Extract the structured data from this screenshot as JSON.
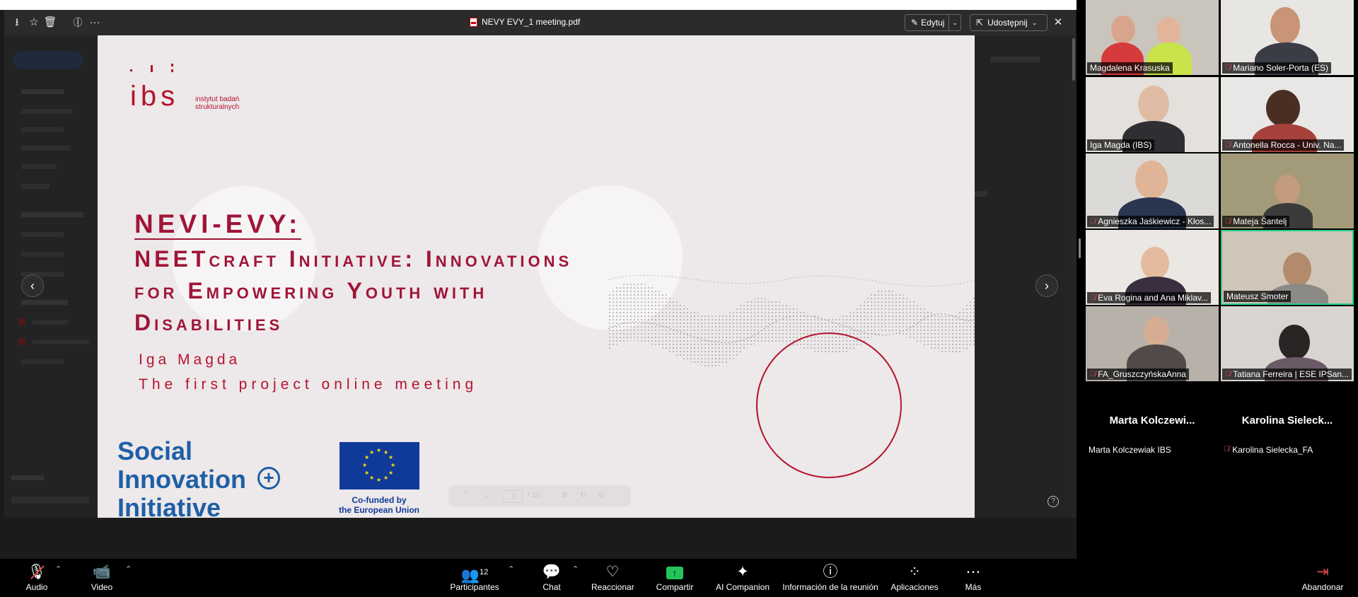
{
  "viewer": {
    "doc_title": "NEVY EVY_1 meeting.pdf",
    "edit_label": "Edytuj",
    "share_label": "Udostępnij",
    "page_current": "1",
    "page_total": "/ 10"
  },
  "slide": {
    "ibs_logo": "ibs",
    "ibs_text": "instytut badań strukturalnych",
    "title": "NEVI-EVY:",
    "subtitle_lines": [
      "NEETcraft Initiative: Innovations",
      "for Empowering Youth with",
      "Disabilities"
    ],
    "author": "Iga Magda",
    "meeting": "The first project online meeting",
    "sii_lines": [
      "Social",
      "Innovation",
      "Initiative"
    ],
    "sii_plus": "+",
    "eu_text_1": "Co-funded by",
    "eu_text_2": "the European Union"
  },
  "participants": [
    {
      "name": "Magdalena Krasuska",
      "muted": false
    },
    {
      "name": "Mariano Soler-Porta (ES)",
      "muted": true
    },
    {
      "name": "Iga Magda (IBS)",
      "muted": false
    },
    {
      "name": "Antonella Rocca - Univ. Na...",
      "muted": true
    },
    {
      "name": "Agnieszka Jaśkiewicz - Kłos...",
      "muted": true
    },
    {
      "name": "Mateja Šantelj",
      "muted": true
    },
    {
      "name": "Eva Rogina and Ana Miklav...",
      "muted": true
    },
    {
      "name": "Mateusz Smoter",
      "muted": false,
      "active": true
    },
    {
      "name": "FA_GruszczyńskaAnna",
      "muted": true
    },
    {
      "name": "Tatiana Ferreira | ESE IPSan...",
      "muted": true
    }
  ],
  "video_off": [
    {
      "display": "Marta  Kolczewi...",
      "label": "Marta Kolczewiak IBS",
      "muted": false
    },
    {
      "display": "Karolina  Sieleck...",
      "label": "Karolina Sielecka_FA",
      "muted": true
    }
  ],
  "toolbar": {
    "audio": "Audio",
    "video": "Video",
    "participants": "Participantes",
    "participants_count": "12",
    "chat": "Chat",
    "react": "Reaccionar",
    "share": "Compartir",
    "ai": "AI Companion",
    "info": "Información de la reunión",
    "apps": "Aplicaciones",
    "more": "Más",
    "leave": "Abandonar"
  },
  "icons": [
    "download-icon",
    "star-icon",
    "trash-icon",
    "info-icon",
    "more-icon",
    "pencil-icon",
    "share-icon",
    "close-icon",
    "mic-off-icon",
    "camera-icon",
    "people-icon",
    "chat-icon",
    "heart-icon",
    "share-screen-icon",
    "sparkle-icon",
    "info-circle-icon",
    "apps-icon",
    "ellipsis-icon",
    "leave-icon"
  ]
}
